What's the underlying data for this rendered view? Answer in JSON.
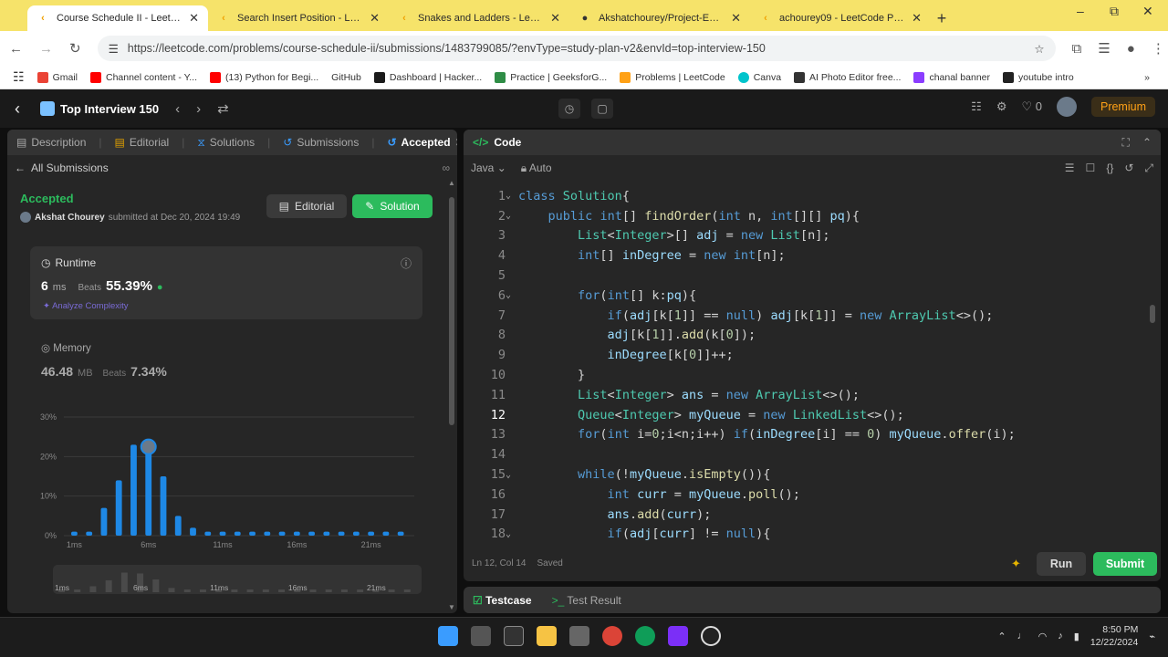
{
  "browser": {
    "tabs": [
      {
        "label": "Course Schedule II - LeetCode",
        "active": true
      },
      {
        "label": "Search Insert Position - LeetCode",
        "active": false
      },
      {
        "label": "Snakes and Ladders - LeetCode",
        "active": false
      },
      {
        "label": "Akshatchourey/Project-Exhibitio",
        "active": false
      },
      {
        "label": "achourey09 - LeetCode Profile",
        "active": false
      }
    ],
    "url": "https://leetcode.com/problems/course-schedule-ii/submissions/1483799085/?envType=study-plan-v2&envId=top-interview-150",
    "bookmarks": [
      {
        "label": "Gmail",
        "color": "#ea4335"
      },
      {
        "label": "Channel content - Y...",
        "color": "#ff0000"
      },
      {
        "label": "(13) Python for Begi...",
        "color": "#ff0000"
      },
      {
        "label": "GitHub",
        "color": "#ffffff"
      },
      {
        "label": "Dashboard | Hacker...",
        "color": "#1ba94c"
      },
      {
        "label": "Practice | GeeksforG...",
        "color": "#2f8d46"
      },
      {
        "label": "Problems | LeetCode",
        "color": "#ffa116"
      },
      {
        "label": "Canva",
        "color": "#00c4cc"
      },
      {
        "label": "AI Photo Editor free...",
        "color": "#333333"
      },
      {
        "label": "chanal banner",
        "color": "#8b3dff"
      },
      {
        "label": "youtube intro",
        "color": "#222222"
      }
    ]
  },
  "header": {
    "study_plan": "Top Interview 150",
    "premium": "Premium",
    "streak": "0"
  },
  "left": {
    "tabs": [
      {
        "label": "Description"
      },
      {
        "label": "Editorial"
      },
      {
        "label": "Solutions"
      },
      {
        "label": "Submissions"
      },
      {
        "label": "Accepted"
      }
    ],
    "back_label": "All Submissions",
    "status": "Accepted",
    "author": "Akshat Chourey",
    "submitted_at": "submitted at Dec 20, 2024 19:49",
    "editorial_btn": "Editorial",
    "solution_btn": "Solution",
    "runtime": {
      "title": "Runtime",
      "value": "6",
      "unit": "ms",
      "beats_label": "Beats",
      "beats": "55.39%",
      "analyze": "Analyze Complexity"
    },
    "memory": {
      "title": "Memory",
      "value": "46.48",
      "unit": "MB",
      "beats_label": "Beats",
      "beats": "7.34%"
    }
  },
  "chart_data": {
    "type": "bar",
    "y_ticks": [
      "30%",
      "20%",
      "10%",
      "0%"
    ],
    "x_ticks": [
      "1ms",
      "6ms",
      "11ms",
      "16ms",
      "21ms"
    ],
    "ylim": [
      0,
      30
    ],
    "values": [
      1,
      1,
      7,
      14,
      23,
      22,
      15,
      5,
      2,
      1,
      1,
      1,
      1,
      1,
      1,
      1,
      1,
      1,
      1,
      1,
      1,
      1,
      1
    ],
    "highlight_index": 5,
    "color": "#1e88e5",
    "mini_x_ticks": [
      "1ms",
      "6ms",
      "11ms",
      "16ms",
      "21ms"
    ]
  },
  "code": {
    "title": "Code",
    "language": "Java",
    "mode": "Auto",
    "current_line": 12,
    "lines": [
      {
        "n": "1",
        "fold": true,
        "t": "class Solution{"
      },
      {
        "n": "2",
        "fold": true,
        "t": "    public int[] findOrder(int n, int[][] pq){"
      },
      {
        "n": "3",
        "fold": false,
        "t": "        List<Integer>[] adj = new List[n];"
      },
      {
        "n": "4",
        "fold": false,
        "t": "        int[] inDegree = new int[n];"
      },
      {
        "n": "5",
        "fold": false,
        "t": ""
      },
      {
        "n": "6",
        "fold": true,
        "t": "        for(int[] k:pq){"
      },
      {
        "n": "7",
        "fold": false,
        "t": "            if(adj[k[1]] == null) adj[k[1]] = new ArrayList<>();"
      },
      {
        "n": "8",
        "fold": false,
        "t": "            adj[k[1]].add(k[0]);"
      },
      {
        "n": "9",
        "fold": false,
        "t": "            inDegree[k[0]]++;"
      },
      {
        "n": "10",
        "fold": false,
        "t": "        }"
      },
      {
        "n": "11",
        "fold": false,
        "t": "        List<Integer> ans = new ArrayList<>();"
      },
      {
        "n": "12",
        "fold": false,
        "t": "        Queue<Integer> myQueue = new LinkedList<>();"
      },
      {
        "n": "13",
        "fold": false,
        "t": "        for(int i=0;i<n;i++) if(inDegree[i] == 0) myQueue.offer(i);"
      },
      {
        "n": "14",
        "fold": false,
        "t": ""
      },
      {
        "n": "15",
        "fold": true,
        "t": "        while(!myQueue.isEmpty()){"
      },
      {
        "n": "16",
        "fold": false,
        "t": "            int curr = myQueue.poll();"
      },
      {
        "n": "17",
        "fold": false,
        "t": "            ans.add(curr);"
      },
      {
        "n": "18",
        "fold": true,
        "t": "            if(adj[curr] != null){"
      }
    ],
    "status": "Ln 12, Col 14",
    "saved": "Saved",
    "run": "Run",
    "submit": "Submit"
  },
  "test": {
    "testcase": "Testcase",
    "result": "Test Result"
  },
  "taskbar": {
    "time": "8:50 PM",
    "date": "12/22/2024"
  }
}
